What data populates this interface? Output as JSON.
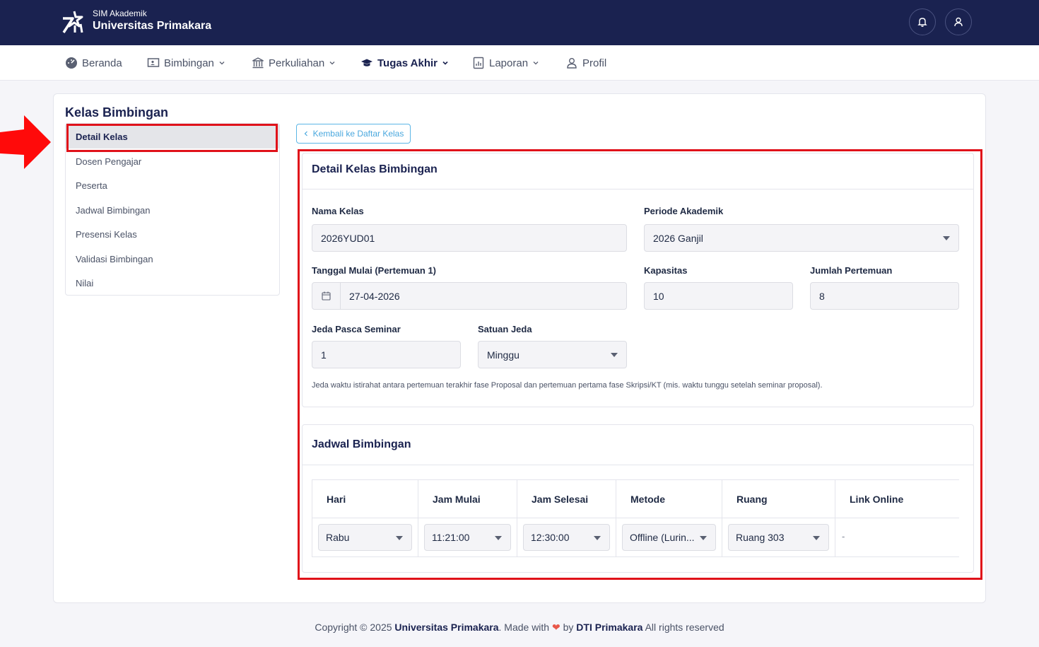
{
  "brand": {
    "subtitle": "SIM Akademik",
    "title": "Universitas Primakara"
  },
  "nav": {
    "items": [
      {
        "label": "Beranda",
        "icon": "dashboard-icon"
      },
      {
        "label": "Bimbingan",
        "icon": "presentation-icon"
      },
      {
        "label": "Perkuliahan",
        "icon": "building-icon"
      },
      {
        "label": "Tugas Akhir",
        "icon": "graduation-cap-icon"
      },
      {
        "label": "Laporan",
        "icon": "report-icon"
      },
      {
        "label": "Profil",
        "icon": "user-icon"
      }
    ]
  },
  "sidebar": {
    "title": "Kelas Bimbingan",
    "items": [
      {
        "label": "Detail Kelas"
      },
      {
        "label": "Dosen Pengajar"
      },
      {
        "label": "Peserta"
      },
      {
        "label": "Jadwal Bimbingan"
      },
      {
        "label": "Presensi Kelas"
      },
      {
        "label": "Validasi Bimbingan"
      },
      {
        "label": "Nilai"
      }
    ]
  },
  "back_button": "Kembali ke Daftar Kelas",
  "detail": {
    "title": "Detail Kelas Bimbingan",
    "nama_kelas": {
      "label": "Nama Kelas",
      "value": "2026YUD01"
    },
    "periode": {
      "label": "Periode Akademik",
      "value": "2026 Ganjil"
    },
    "tanggal_mulai": {
      "label": "Tanggal Mulai (Pertemuan 1)",
      "value": "27-04-2026"
    },
    "kapasitas": {
      "label": "Kapasitas",
      "value": "10"
    },
    "jumlah_pertemuan": {
      "label": "Jumlah Pertemuan",
      "value": "8"
    },
    "jeda": {
      "label": "Jeda Pasca Seminar",
      "value": "1"
    },
    "satuan_jeda": {
      "label": "Satuan Jeda",
      "value": "Minggu"
    },
    "hint": "Jeda waktu istirahat antara pertemuan terakhir fase Proposal dan pertemuan pertama fase Skripsi/KT (mis. waktu tunggu setelah seminar proposal)."
  },
  "jadwal": {
    "title": "Jadwal Bimbingan",
    "columns": [
      "Hari",
      "Jam Mulai",
      "Jam Selesai",
      "Metode",
      "Ruang",
      "Link Online"
    ],
    "row": {
      "hari": "Rabu",
      "jam_mulai": "11:21:00",
      "jam_selesai": "12:30:00",
      "metode": "Offline (Lurin...",
      "ruang": "Ruang 303",
      "link": "-"
    }
  },
  "footer": {
    "prefix": "Copyright © 2025",
    "org": "Universitas Primakara",
    "made": ". Made with",
    "by": "by",
    "team": "DTI Primakara",
    "rights": "All rights reserved"
  },
  "colors": {
    "topbar": "#1a2250",
    "highlight": "#e0121a",
    "accent": "#4aa8de"
  }
}
